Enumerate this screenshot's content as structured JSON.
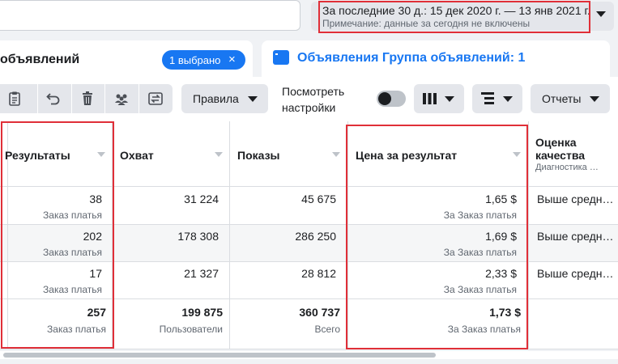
{
  "date_range": {
    "label": "За последние 30 д.: 15 дек 2020 г. — 13 янв 2021 г.",
    "note": "Примечание: данные за сегодня не включены"
  },
  "tabs": {
    "ads_label": "объявлений",
    "selected_label": "1 выбрано",
    "selected_close": "×",
    "group_label": "Объявления Группа объявлений: 1"
  },
  "toolbar": {
    "rules_label": "Правила",
    "view_settings_label": "Посмотреть настройки",
    "reports_label": "Отчеты",
    "icons": [
      "clipboard-icon",
      "undo-icon",
      "trash-icon",
      "people-icon",
      "swap-icon",
      "columns-icon",
      "breakdown-icon"
    ]
  },
  "table": {
    "headers": {
      "results": "Результаты",
      "reach": "Охват",
      "impressions": "Показы",
      "cost": "Цена за результат",
      "quality": "Оценка качества",
      "quality_sub": "Диагностика …"
    },
    "rows": [
      {
        "results": "38",
        "results_sub": "Заказ платья",
        "reach": "31 224",
        "impressions": "45 675",
        "cost": "1,65 $",
        "cost_sub": "За Заказ платья",
        "quality": "Выше средн…"
      },
      {
        "results": "202",
        "results_sub": "Заказ платья",
        "reach": "178 308",
        "impressions": "286 250",
        "cost": "1,69 $",
        "cost_sub": "За Заказ платья",
        "quality": "Выше средн…"
      },
      {
        "results": "17",
        "results_sub": "Заказ платья",
        "reach": "21 327",
        "impressions": "28 812",
        "cost": "2,33 $",
        "cost_sub": "За Заказ платья",
        "quality": "Выше средн…"
      }
    ],
    "totals": {
      "results": "257",
      "results_sub": "Заказ платья",
      "reach": "199 875",
      "reach_sub": "Пользователи",
      "impressions": "360 737",
      "impressions_sub": "Всего",
      "cost": "1,73 $",
      "cost_sub": "За Заказ платья"
    }
  },
  "colors": {
    "accent": "#1877f2",
    "highlight": "#e02f38"
  }
}
